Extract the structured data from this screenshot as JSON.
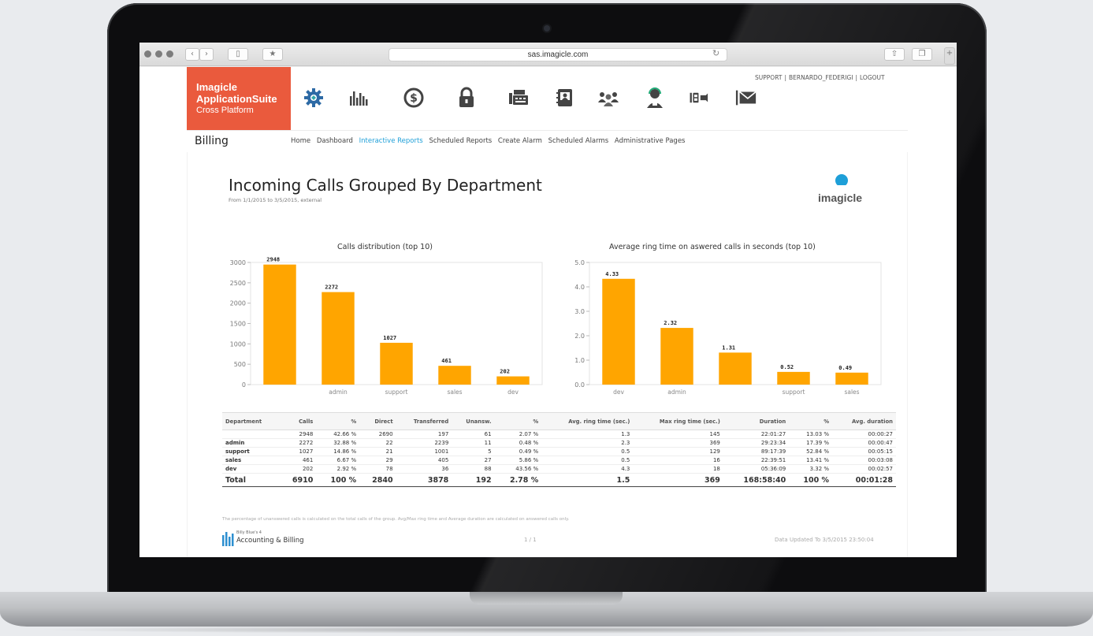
{
  "browser": {
    "url": "sas.imagicle.com"
  },
  "app": {
    "logo": {
      "line1": "Imagicle",
      "line2": "ApplicationSuite",
      "line3": "Cross Platform",
      "color": "#ea5a3d"
    },
    "nav_icons": [
      "gear-icon",
      "bar-chart-icon",
      "dollar-icon",
      "lock-icon",
      "fax-icon",
      "contact-card-icon",
      "group-icon",
      "operator-icon",
      "queue-icon",
      "envelope-icon"
    ],
    "top_links": [
      "SUPPORT",
      "BERNARDO_FEDERIGI",
      "LOGOUT"
    ],
    "module_title": "Billing",
    "tabs": [
      {
        "label": "Home",
        "active": false
      },
      {
        "label": "Dashboard",
        "active": false
      },
      {
        "label": "Interactive Reports",
        "active": true
      },
      {
        "label": "Scheduled Reports",
        "active": false
      },
      {
        "label": "Create Alarm",
        "active": false
      },
      {
        "label": "Scheduled Alarms",
        "active": false
      },
      {
        "label": "Administrative Pages",
        "active": false
      }
    ],
    "accent_color": "#1e9fd8"
  },
  "report": {
    "title": "Incoming Calls Grouped By Department",
    "subtitle": "From 1/1/2015 to 3/5/2015, external",
    "brand": "imagicle",
    "footnote": "The percentage of unanswered calls is calculated on the total calls of the group. Avg/Max ring time and Average duration are calculated on answered calls only.",
    "footer_small": "Billy Blue's 4",
    "footer_brand": "Accounting & Billing",
    "page": "1 / 1",
    "updated": "Data Updated To 3/5/2015 23:50:04"
  },
  "chart_data": [
    {
      "type": "bar",
      "title": "Calls distribution (top 10)",
      "categories": [
        "",
        "admin",
        "support",
        "sales",
        "dev"
      ],
      "values": [
        2948,
        2272,
        1027,
        461,
        202
      ],
      "data_labels": [
        "2948",
        "2272",
        "1027",
        "461",
        "202"
      ],
      "ylim": [
        0,
        3000
      ],
      "yticks": [
        "0",
        "500",
        "1000",
        "1500",
        "2000",
        "2500",
        "3000"
      ],
      "bar_color": "#ffa500"
    },
    {
      "type": "bar",
      "title": "Average ring time on aswered calls in seconds (top 10)",
      "categories": [
        "dev",
        "admin",
        "",
        "support",
        "sales"
      ],
      "values": [
        4.33,
        2.32,
        1.31,
        0.52,
        0.49
      ],
      "data_labels": [
        "4.33",
        "2.32",
        "1.31",
        "0.52",
        "0.49"
      ],
      "ylim": [
        0,
        5
      ],
      "yticks": [
        "0.0",
        "1.0",
        "2.0",
        "3.0",
        "4.0",
        "5.0"
      ],
      "bar_color": "#ffa500"
    }
  ],
  "table": {
    "headers": [
      "Department",
      "Calls",
      "%",
      "Direct",
      "Transferred",
      "Unansw.",
      "%",
      "Avg. ring time (sec.)",
      "Max ring time (sec.)",
      "Duration",
      "%",
      "Avg. duration"
    ],
    "rows": [
      [
        "",
        "2948",
        "42.66 %",
        "2690",
        "197",
        "61",
        "2.07 %",
        "1.3",
        "145",
        "22:01:27",
        "13.03 %",
        "00:00:27"
      ],
      [
        "admin",
        "2272",
        "32.88 %",
        "22",
        "2239",
        "11",
        "0.48 %",
        "2.3",
        "369",
        "29:23:34",
        "17.39 %",
        "00:00:47"
      ],
      [
        "support",
        "1027",
        "14.86 %",
        "21",
        "1001",
        "5",
        "0.49 %",
        "0.5",
        "129",
        "89:17:39",
        "52.84 %",
        "00:05:15"
      ],
      [
        "sales",
        "461",
        "6.67 %",
        "29",
        "405",
        "27",
        "5.86 %",
        "0.5",
        "16",
        "22:39:51",
        "13.41 %",
        "00:03:08"
      ],
      [
        "dev",
        "202",
        "2.92 %",
        "78",
        "36",
        "88",
        "43.56 %",
        "4.3",
        "18",
        "05:36:09",
        "3.32 %",
        "00:02:57"
      ]
    ],
    "total": [
      "Total",
      "6910",
      "100 %",
      "2840",
      "3878",
      "192",
      "2.78 %",
      "1.5",
      "369",
      "168:58:40",
      "100 %",
      "00:01:28"
    ]
  }
}
